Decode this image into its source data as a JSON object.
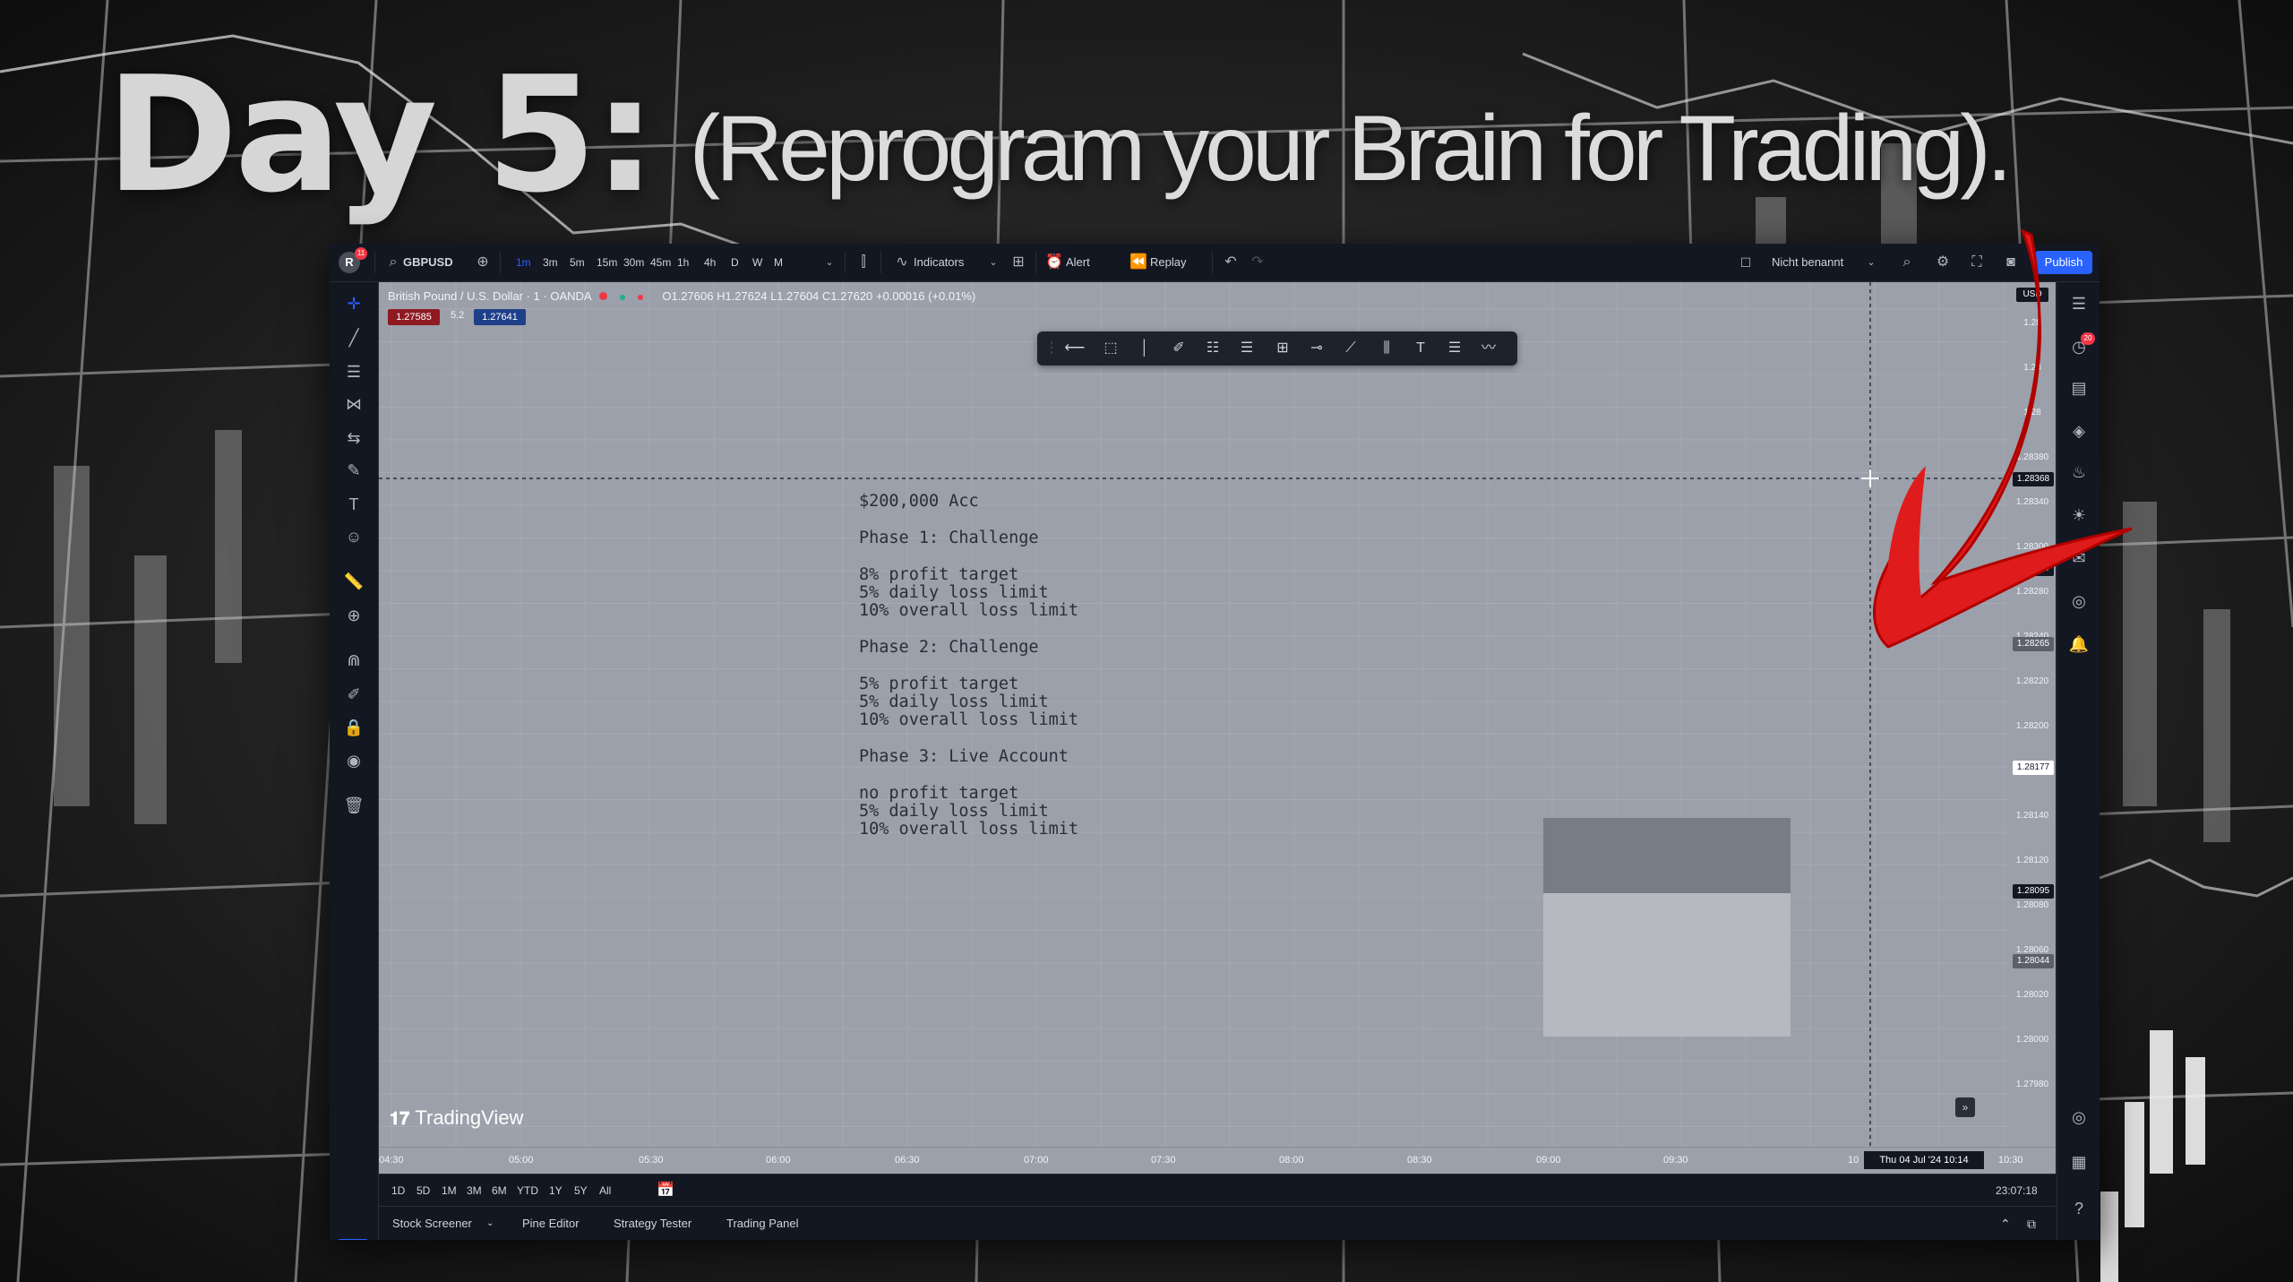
{
  "headline": {
    "day": "Day 5:",
    "subtitle": "(Reprogram your Brain for Trading)."
  },
  "topbar": {
    "avatar_label": "R",
    "avatar_badge": "11",
    "symbol": "GBPUSD",
    "timeframes": [
      "1m",
      "3m",
      "5m",
      "15m",
      "30m",
      "45m",
      "1h",
      "4h",
      "D",
      "W",
      "M"
    ],
    "active_timeframe": "1m",
    "indicators_label": "Indicators",
    "alert_label": "Alert",
    "replay_label": "Replay",
    "layout_name": "Nicht benannt",
    "publish_label": "Publish"
  },
  "legend": {
    "title": "British Pound / U.S. Dollar · 1 · OANDA",
    "ohlc": "O1.27606 H1.27624 L1.27604 C1.27620 +0.00016 (+0.01%)",
    "sell_price": "1.27585",
    "spread": "5.2",
    "buy_price": "1.27641"
  },
  "notes": {
    "lines": [
      "$200,000 Acc",
      "",
      "Phase 1: Challenge",
      "",
      "8% profit target",
      "5% daily loss limit",
      "10% overall loss limit",
      "",
      "Phase 2: Challenge",
      "",
      "5% profit target",
      "5% daily loss limit",
      "10% overall loss limit",
      "",
      "Phase 3: Live Account",
      "",
      "no profit target",
      "5% daily loss limit",
      "10% overall loss limit"
    ]
  },
  "price_axis": {
    "currency": "USD",
    "labels": [
      "1.28",
      "1.28",
      "1.28",
      "1.28380",
      "1.28340",
      "1.28300",
      "1.28280",
      "1.28240",
      "1.28220",
      "1.28200",
      "1.28160",
      "1.28140",
      "1.28120",
      "1.28080",
      "1.28060",
      "1.28020",
      "1.28000",
      "1.27980"
    ],
    "highlight_labels": [
      "1.28368",
      "1.28309",
      "1.28265",
      "1.28177",
      "1.28095",
      "1.28044"
    ]
  },
  "time_axis": {
    "labels": [
      "04:30",
      "05:00",
      "05:30",
      "06:00",
      "06:30",
      "07:00",
      "07:30",
      "08:00",
      "08:30",
      "09:00",
      "09:30",
      "10",
      "10:30"
    ],
    "crosshair_time": "Thu 04 Jul '24   10:14"
  },
  "range_bar": {
    "ranges": [
      "1D",
      "5D",
      "1M",
      "3M",
      "6M",
      "YTD",
      "1Y",
      "5Y",
      "All"
    ],
    "clock": "23:07:18 (UTC+2)"
  },
  "panel_bar": {
    "tabs": [
      "Stock Screener",
      "Pine Editor",
      "Strategy Tester",
      "Trading Panel"
    ]
  },
  "branding": {
    "logo_text": "TradingView"
  },
  "right_badge": "20",
  "colors": {
    "accent": "#2962ff",
    "chart_bg": "#9ba0aa",
    "panel_bg": "#131722",
    "arrow": "#e01b1b"
  }
}
